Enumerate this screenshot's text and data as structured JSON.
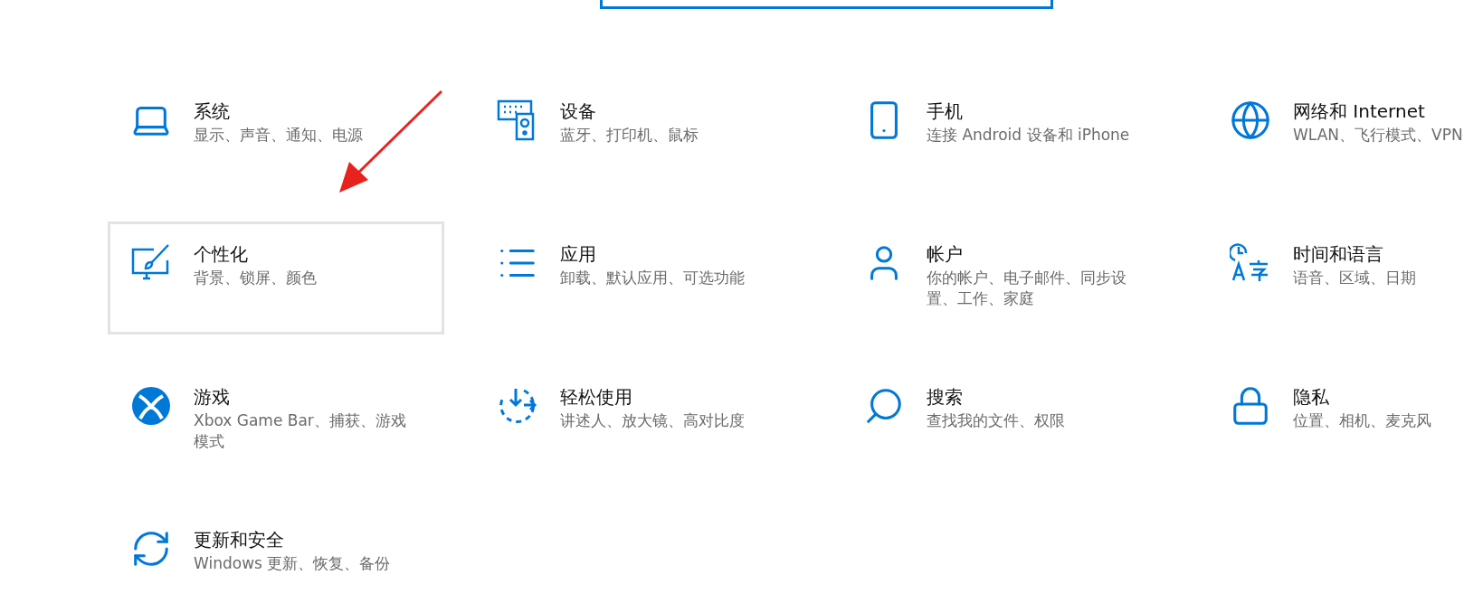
{
  "tiles": [
    {
      "title": "系统",
      "description": "显示、声音、通知、电源",
      "selected": false
    },
    {
      "title": "设备",
      "description": "蓝牙、打印机、鼠标",
      "selected": false
    },
    {
      "title": "手机",
      "description": "连接 Android 设备和 iPhone",
      "selected": false
    },
    {
      "title": "网络和 Internet",
      "description": "WLAN、飞行模式、VPN",
      "selected": false
    },
    {
      "title": "个性化",
      "description": "背景、锁屏、颜色",
      "selected": true
    },
    {
      "title": "应用",
      "description": "卸载、默认应用、可选功能",
      "selected": false
    },
    {
      "title": "帐户",
      "description": "你的帐户、电子邮件、同步设置、工作、家庭",
      "selected": false
    },
    {
      "title": "时间和语言",
      "description": "语音、区域、日期",
      "selected": false
    },
    {
      "title": "游戏",
      "description": "Xbox Game Bar、捕获、游戏模式",
      "selected": false
    },
    {
      "title": "轻松使用",
      "description": "讲述人、放大镜、高对比度",
      "selected": false
    },
    {
      "title": "搜索",
      "description": "查找我的文件、权限",
      "selected": false
    },
    {
      "title": "隐私",
      "description": "位置、相机、麦克风",
      "selected": false
    },
    {
      "title": "更新和安全",
      "description": "Windows 更新、恢复、备份",
      "selected": false
    }
  ],
  "annotation": {
    "kind": "arrow",
    "color": "#e8231d"
  }
}
